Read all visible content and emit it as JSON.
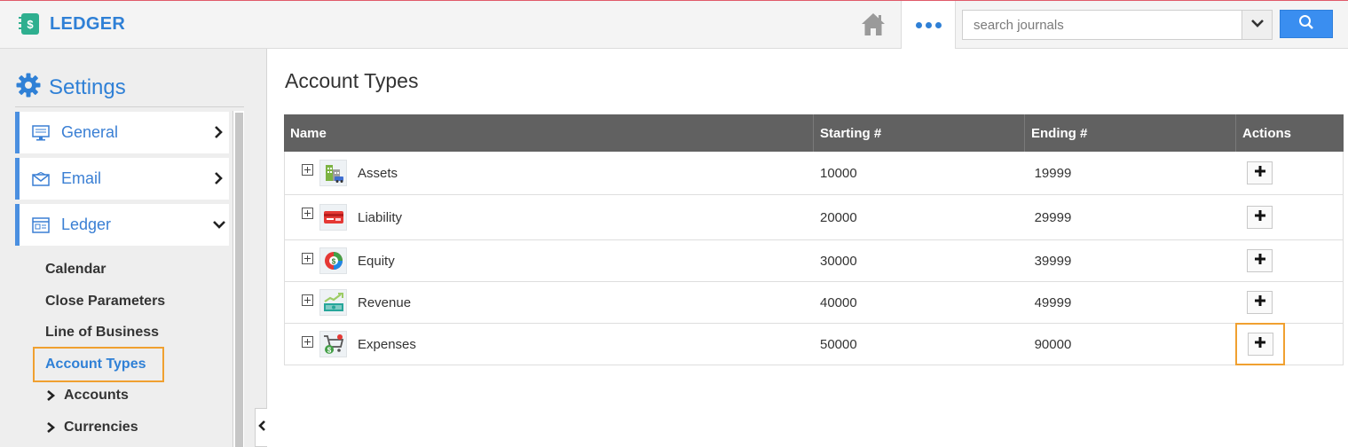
{
  "app": {
    "brand": "LEDGER",
    "brand_icon": "ledger-book-icon",
    "accent_color": "#2f80d6"
  },
  "header": {
    "home_icon": "home-icon",
    "more_icon": "more-dots-icon",
    "search": {
      "placeholder": "search journals",
      "value": "",
      "dropdown_icon": "chevron-down-icon",
      "button_icon": "search-icon"
    }
  },
  "sidebar": {
    "title": "Settings",
    "title_icon": "gear-icon",
    "sections": [
      {
        "label": "General",
        "icon": "monitor-icon",
        "state": "collapsed"
      },
      {
        "label": "Email",
        "icon": "envelope-icon",
        "state": "collapsed"
      },
      {
        "label": "Ledger",
        "icon": "ledger-icon",
        "state": "expanded"
      }
    ],
    "ledger_items": [
      {
        "label": "Calendar",
        "active": false
      },
      {
        "label": "Close Parameters",
        "active": false
      },
      {
        "label": "Line of Business",
        "active": false
      },
      {
        "label": "Account Types",
        "active": true
      }
    ],
    "ledger_trees": [
      {
        "label": "Accounts"
      },
      {
        "label": "Currencies"
      }
    ]
  },
  "main": {
    "title": "Account Types",
    "table": {
      "columns": [
        "Name",
        "Starting #",
        "Ending #",
        "Actions"
      ],
      "rows": [
        {
          "name": "Assets",
          "start": "10000",
          "end": "19999",
          "icon": "building-icon"
        },
        {
          "name": "Liability",
          "start": "20000",
          "end": "29999",
          "icon": "credit-card-icon"
        },
        {
          "name": "Equity",
          "start": "30000",
          "end": "39999",
          "icon": "pie-chart-dollar-icon"
        },
        {
          "name": "Revenue",
          "start": "40000",
          "end": "49999",
          "icon": "money-growth-icon"
        },
        {
          "name": "Expenses",
          "start": "50000",
          "end": "90000",
          "icon": "shopping-cart-dollar-icon"
        }
      ],
      "action_icon": "plus-icon",
      "highlighted_action_row": 4
    }
  }
}
